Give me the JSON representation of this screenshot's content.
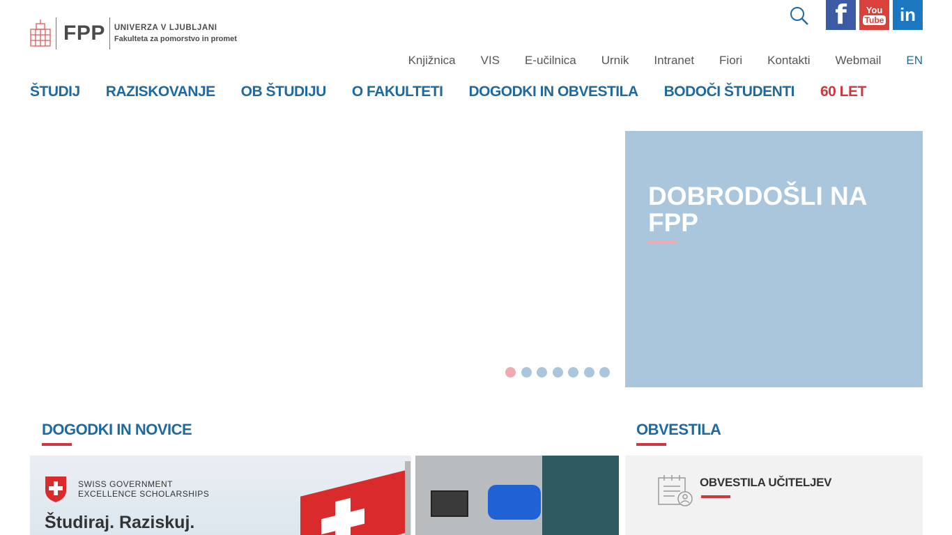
{
  "logo": {
    "abbr": "FPP",
    "university": "UNIVERZA V LJUBLJANI",
    "faculty": "Fakulteta za pomorstvo in promet"
  },
  "social": {
    "facebook": "f",
    "youtube_top": "You",
    "youtube_bottom": "Tube",
    "linkedin": "in"
  },
  "util_nav": [
    "Knjižnica",
    "VIS",
    "E-učilnica",
    "Urnik",
    "Intranet",
    "Fiori",
    "Kontakti",
    "Webmail",
    "EN"
  ],
  "main_nav": [
    "ŠTUDIJ",
    "RAZISKOVANJE",
    "OB ŠTUDIJU",
    "O FAKULTETI",
    "DOGODKI IN OBVESTILA",
    "BODOČI ŠTUDENTI",
    "60 LET"
  ],
  "hero": {
    "title": "DOBRODOŠLI NA FPP",
    "slides": 7,
    "active_slide": 0
  },
  "sections": {
    "events_title": "DOGODKI IN NOVICE",
    "notices_title": "OBVESTILA"
  },
  "card1": {
    "line1": "SWISS GOVERNMENT",
    "line2": "EXCELLENCE SCHOLARSHIPS",
    "slogan": "Študiraj. Raziskuj."
  },
  "notice": {
    "title": "OBVESTILA UČITELJEV"
  },
  "colors": {
    "brand_blue": "#1e6aa0",
    "brand_red": "#d0363e",
    "hero_panel": "#a9c6dc",
    "dot_active": "#f0a9ae"
  }
}
